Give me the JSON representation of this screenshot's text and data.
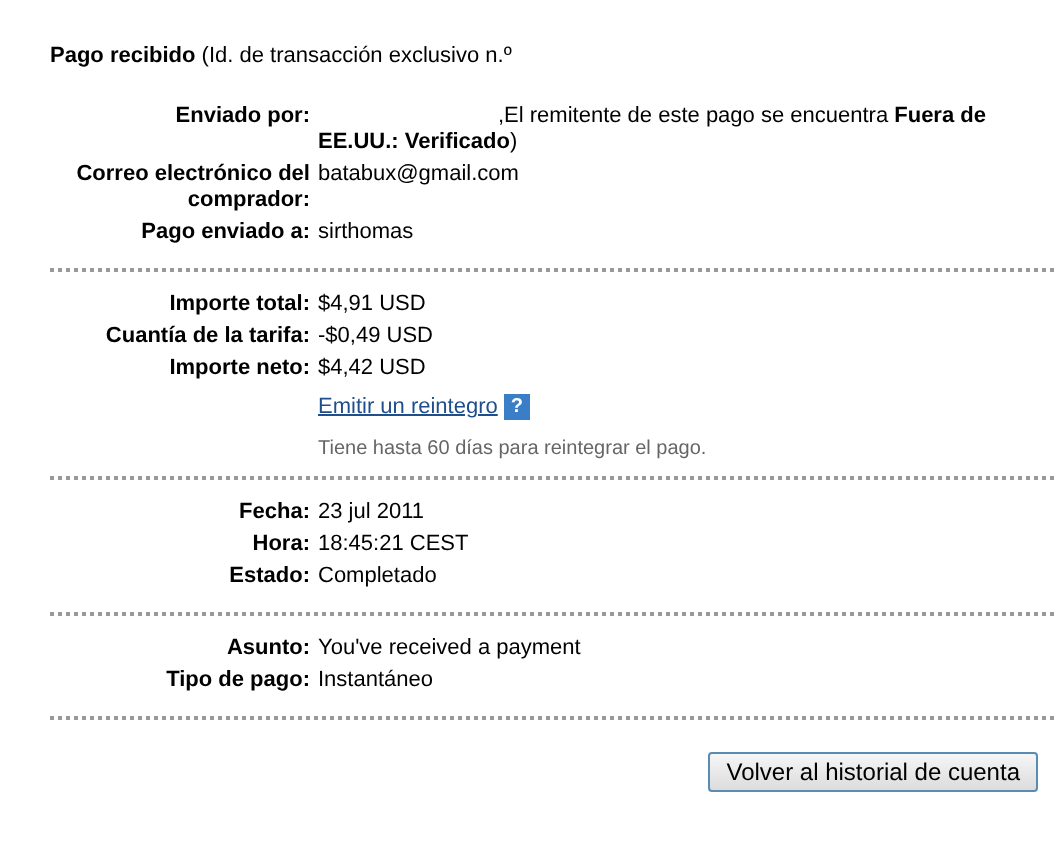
{
  "header": "**Pago recibido** (Id. de transacción exclusivo n.º",
  "sections": [
    {
      "rows": [
        {
          "label": "Enviado por:",
          "value": ",El remitente de este pago se encuentra **Fuera de EE.UU.: Verificado**)",
          "kind": "redacted"
        },
        {
          "label": "Correo electrónico del comprador:",
          "value": "batabux@gmail.com",
          "kind": "plain"
        },
        {
          "label": "Pago enviado a:",
          "value": "sirthomas",
          "kind": "plain"
        }
      ]
    },
    {
      "rows": [
        {
          "label": "Importe total:",
          "value": "$4,91 USD",
          "kind": "plain"
        },
        {
          "label": "Cuantía de la tarifa:",
          "value": "-$0,49 USD",
          "kind": "plain"
        },
        {
          "label": "Importe neto:",
          "value": "$4,42 USD",
          "kind": "plain"
        }
      ],
      "refund": {
        "link": "Emitir un reintegro",
        "help": "?",
        "note": "Tiene hasta 60 días para reintegrar el pago."
      }
    },
    {
      "rows": [
        {
          "label": "Fecha:",
          "value": "23 jul 2011",
          "kind": "plain"
        },
        {
          "label": "Hora:",
          "value": "18:45:21 CEST",
          "kind": "plain"
        },
        {
          "label": "Estado:",
          "value": "Completado",
          "kind": "plain"
        }
      ]
    },
    {
      "rows": [
        {
          "label": "Asunto:",
          "value": "You've received a payment",
          "kind": "plain"
        },
        {
          "label": "Tipo de pago:",
          "value": "Instantáneo",
          "kind": "plain"
        }
      ]
    }
  ],
  "button": "Volver al historial de cuenta"
}
